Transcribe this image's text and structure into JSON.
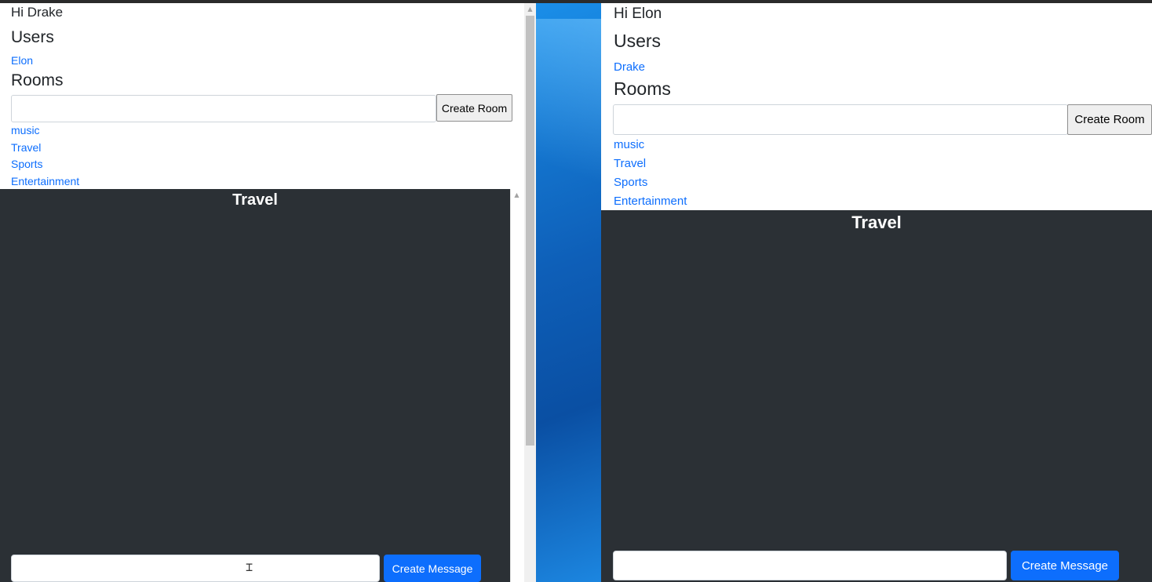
{
  "left": {
    "greeting": "Hi Drake",
    "users_heading": "Users",
    "users": [
      "Elon"
    ],
    "rooms_heading": "Rooms",
    "room_input_value": "",
    "create_room_label": "Create Room",
    "rooms": [
      "music",
      "Travel",
      "Sports",
      "Entertainment"
    ],
    "chat_title": "Travel",
    "message_input_value": "",
    "create_message_label": "Create Message"
  },
  "right": {
    "greeting": "Hi Elon",
    "users_heading": "Users",
    "users": [
      "Drake"
    ],
    "rooms_heading": "Rooms",
    "room_input_value": "",
    "create_room_label": "Create Room",
    "rooms": [
      "music",
      "Travel",
      "Sports",
      "Entertainment"
    ],
    "chat_title": "Travel",
    "message_input_value": "",
    "create_message_label": "Create Message"
  },
  "colors": {
    "link": "#0d6efd",
    "chat_background": "#2b3035",
    "primary_button": "#0d6efd",
    "desktop": "#0f6fc9"
  },
  "icons": {
    "scroll_up": "chevron-up-icon",
    "text_cursor": "i-beam-cursor-icon"
  }
}
